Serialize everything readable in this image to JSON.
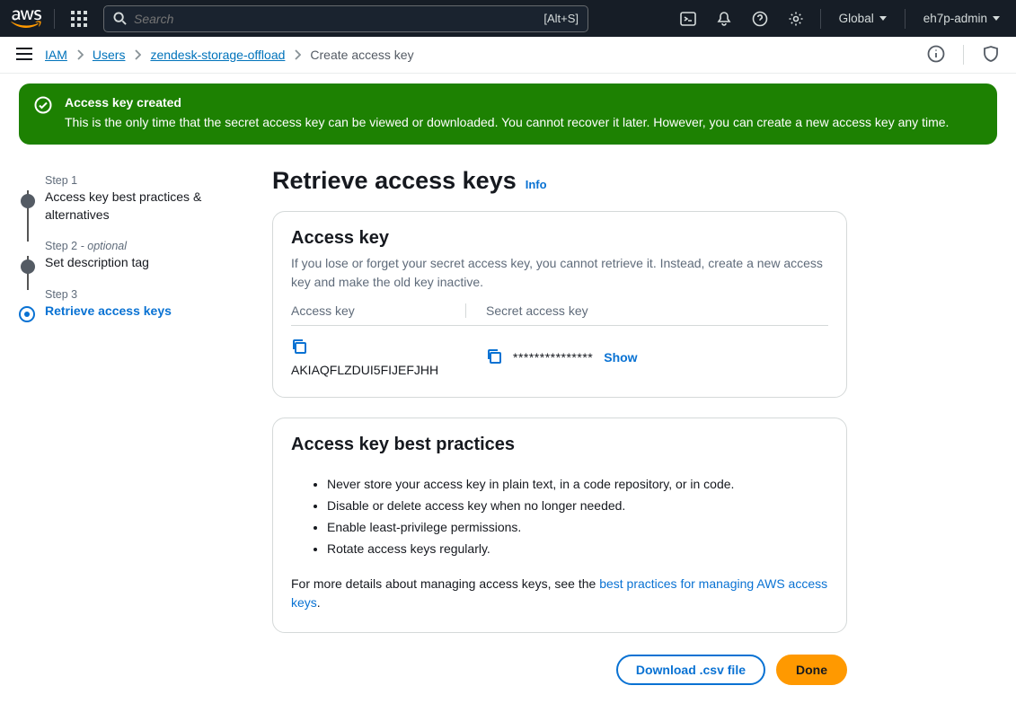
{
  "topnav": {
    "search_placeholder": "Search",
    "search_kbd": "[Alt+S]",
    "region": "Global",
    "account": "eh7p-admin"
  },
  "breadcrumb": {
    "items": [
      "IAM",
      "Users",
      "zendesk-storage-offload"
    ],
    "current": "Create access key"
  },
  "alert": {
    "title": "Access key created",
    "body": "This is the only time that the secret access key can be viewed or downloaded. You cannot recover it later. However, you can create a new access key any time."
  },
  "stepper": [
    {
      "label": "Step 1",
      "optional": "",
      "title": "Access key best practices & alternatives",
      "active": false
    },
    {
      "label": "Step 2",
      "optional": " - optional",
      "title": "Set description tag",
      "active": false
    },
    {
      "label": "Step 3",
      "optional": "",
      "title": "Retrieve access keys",
      "active": true
    }
  ],
  "page": {
    "title": "Retrieve access keys",
    "info": "Info"
  },
  "access_panel": {
    "heading": "Access key",
    "desc": "If you lose or forget your secret access key, you cannot retrieve it. Instead, create a new access key and make the old key inactive.",
    "col_access": "Access key",
    "col_secret": "Secret access key",
    "access_key_value": "AKIAQFLZDUI5FIJEFJHH",
    "secret_mask": "***************",
    "show_label": "Show"
  },
  "bp_panel": {
    "heading": "Access key best practices",
    "items": [
      "Never store your access key in plain text, in a code repository, or in code.",
      "Disable or delete access key when no longer needed.",
      "Enable least-privilege permissions.",
      "Rotate access keys regularly."
    ],
    "footer_pre": "For more details about managing access keys, see the ",
    "footer_link": "best practices for managing AWS access keys",
    "footer_post": "."
  },
  "actions": {
    "download": "Download .csv file",
    "done": "Done"
  }
}
